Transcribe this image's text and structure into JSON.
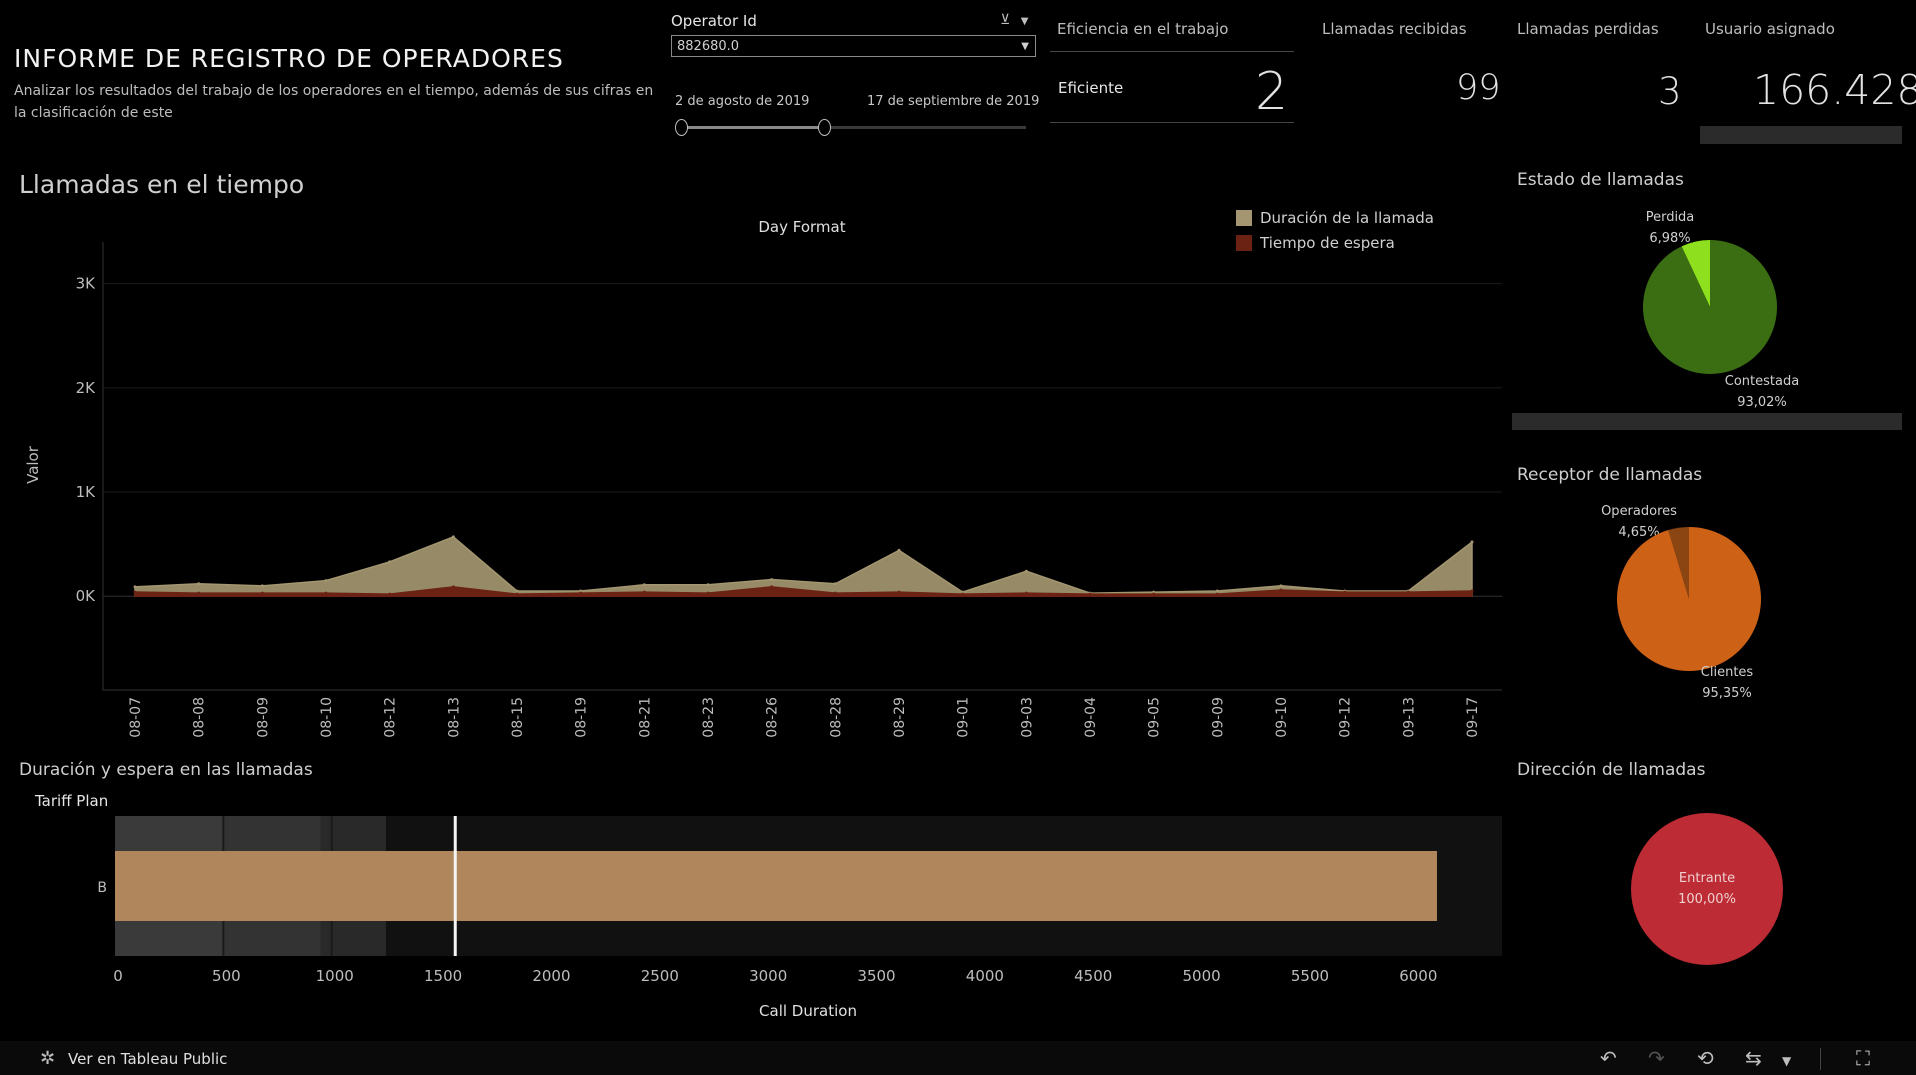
{
  "header": {
    "title": "INFORME DE REGISTRO DE OPERADORES",
    "subtitle": "Analizar los resultados del trabajo de los operadores en el tiempo, además de sus cifras en la clasificación de este"
  },
  "filter": {
    "label": "Operator Id",
    "value": "882680.0",
    "date_start": "2 de agosto de 2019",
    "date_end": "17 de septiembre de 2019"
  },
  "kpis": {
    "efficiency_label": "Eficiencia en el trabajo",
    "efficiency_category": "Eficiente",
    "efficiency_value": "2",
    "received_label": "Llamadas recibidas",
    "received_value": "99",
    "lost_label": "Llamadas perdidas",
    "lost_value": "3",
    "user_label": "Usuario asignado",
    "user_value": "166.428"
  },
  "sections": {
    "timeline": "Llamadas en el tiempo",
    "duration": "Duración y espera en las llamadas",
    "status": "Estado de llamadas",
    "receiver": "Receptor de llamadas",
    "direction": "Dirección de llamadas"
  },
  "footer": {
    "tableau_link": "Ver en Tableau Public"
  },
  "colors": {
    "duration_area": "#a39670",
    "wait_area": "#6b2213",
    "bar": "#b0875c",
    "answered": "#3b6d12",
    "lost": "#8ee01e",
    "clients": "#cd6116",
    "operators": "#8a4512",
    "incoming": "#bd2b35"
  },
  "chart_data": [
    {
      "type": "area",
      "title": "Day Format",
      "ylabel": "Valor",
      "xlabel": "",
      "ylim": [
        -900,
        3400
      ],
      "yticks": [
        "3K",
        "2K",
        "1K",
        "0K"
      ],
      "ytick_values": [
        3000,
        2000,
        1000,
        0
      ],
      "legend_position": "top-right",
      "x": [
        "08-07",
        "08-08",
        "08-09",
        "08-10",
        "08-12",
        "08-13",
        "08-15",
        "08-19",
        "08-21",
        "08-23",
        "08-26",
        "08-28",
        "08-29",
        "09-01",
        "09-03",
        "09-04",
        "09-05",
        "09-09",
        "09-10",
        "09-12",
        "09-13",
        "09-17"
      ],
      "series": [
        {
          "name": "Duración de la llamada",
          "values": [
            90,
            120,
            100,
            150,
            330,
            570,
            50,
            50,
            110,
            110,
            160,
            120,
            440,
            40,
            240,
            30,
            40,
            50,
            100,
            50,
            50,
            520
          ]
        },
        {
          "name": "Tiempo de espera",
          "values": [
            40,
            30,
            30,
            30,
            20,
            90,
            20,
            30,
            40,
            30,
            90,
            30,
            40,
            20,
            30,
            20,
            20,
            20,
            60,
            40,
            40,
            50
          ]
        }
      ]
    },
    {
      "type": "bar",
      "orientation": "horizontal",
      "ylabel": "Tariff Plan",
      "xlabel": "Call Duration",
      "categories": [
        "B"
      ],
      "values": [
        6100
      ],
      "reference_line": 1570,
      "bands": [
        500,
        950,
        1000,
        1250
      ],
      "xlim": [
        0,
        6400
      ],
      "xticks": [
        0,
        500,
        1000,
        1500,
        2000,
        2500,
        3000,
        3500,
        4000,
        4500,
        5000,
        5500,
        6000
      ]
    },
    {
      "type": "pie",
      "title": "Estado de llamadas",
      "slices": [
        {
          "label": "Perdida",
          "value": 6.98,
          "text": "6,98%"
        },
        {
          "label": "Contestada",
          "value": 93.02,
          "text": "93,02%"
        }
      ]
    },
    {
      "type": "pie",
      "title": "Receptor de llamadas",
      "slices": [
        {
          "label": "Operadores",
          "value": 4.65,
          "text": "4,65%"
        },
        {
          "label": "Clientes",
          "value": 95.35,
          "text": "95,35%"
        }
      ]
    },
    {
      "type": "pie",
      "title": "Dirección de llamadas",
      "slices": [
        {
          "label": "Entrante",
          "value": 100,
          "text": "100,00%"
        }
      ]
    }
  ]
}
